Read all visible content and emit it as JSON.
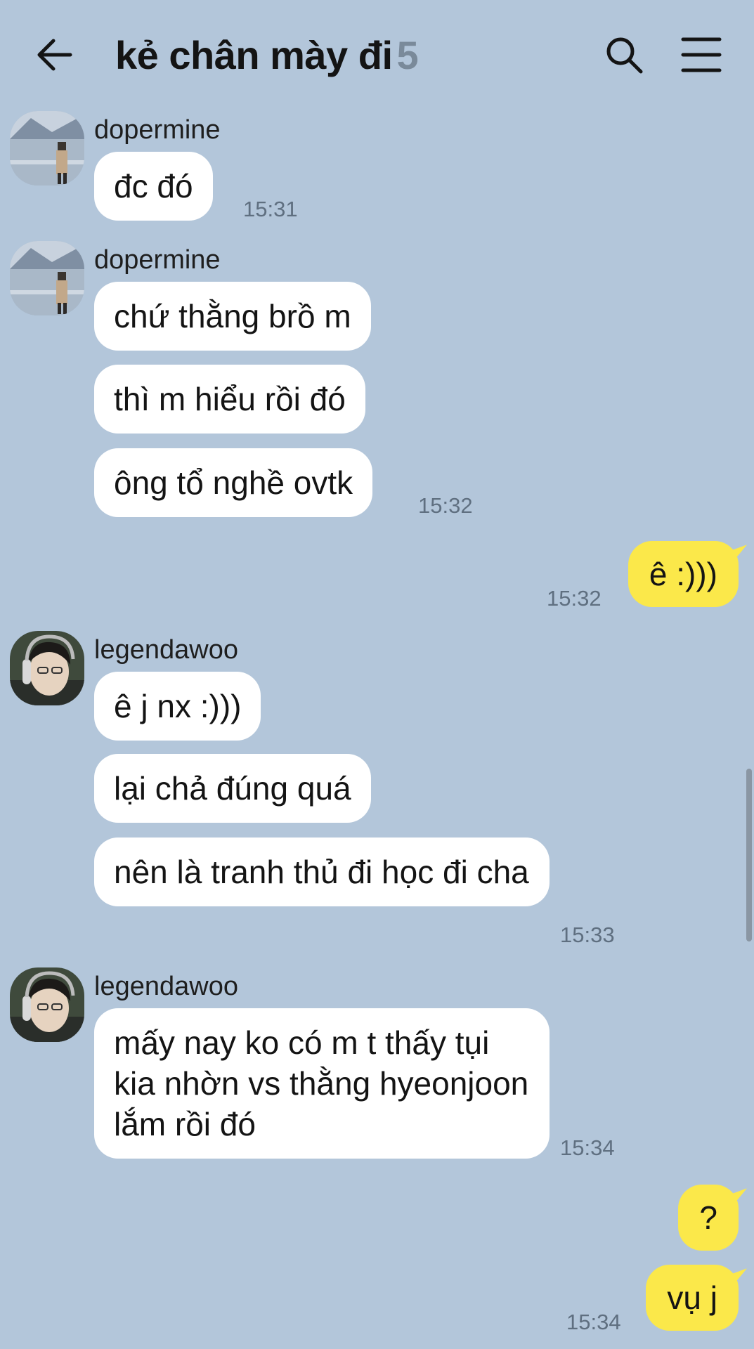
{
  "header": {
    "title": "kẻ chân mày đi",
    "member_count": "5",
    "back_icon": "arrow-left-icon",
    "search_icon": "search-icon",
    "menu_icon": "hamburger-menu-icon"
  },
  "colors": {
    "background": "#b3c6da",
    "incoming_bubble": "#ffffff",
    "outgoing_bubble": "#fbe84a",
    "timestamp": "#5f6f80"
  },
  "messages": {
    "g1": {
      "sender": "dopermine",
      "m1": "đc đó",
      "time": "15:31"
    },
    "g2": {
      "sender": "dopermine",
      "m1": "chứ thằng brồ m",
      "m2": "thì m hiểu rồi đó",
      "m3": "ông tổ nghề ovtk",
      "time": "15:32"
    },
    "me1": {
      "m1": "ê :)))",
      "time": "15:32"
    },
    "g3": {
      "sender": "legendawoo",
      "m1": "ê j nx :)))",
      "m2": "lại chả đúng quá",
      "m3": "nên là tranh thủ đi học đi cha",
      "time": "15:33"
    },
    "g4": {
      "sender": "legendawoo",
      "m1": "mấy nay ko có m t thấy tụi kia nhờn vs thằng hyeonjoon lắm rồi đó",
      "time": "15:34"
    },
    "me2": {
      "m1": "?",
      "m2": "vụ j",
      "time": "15:34"
    }
  }
}
